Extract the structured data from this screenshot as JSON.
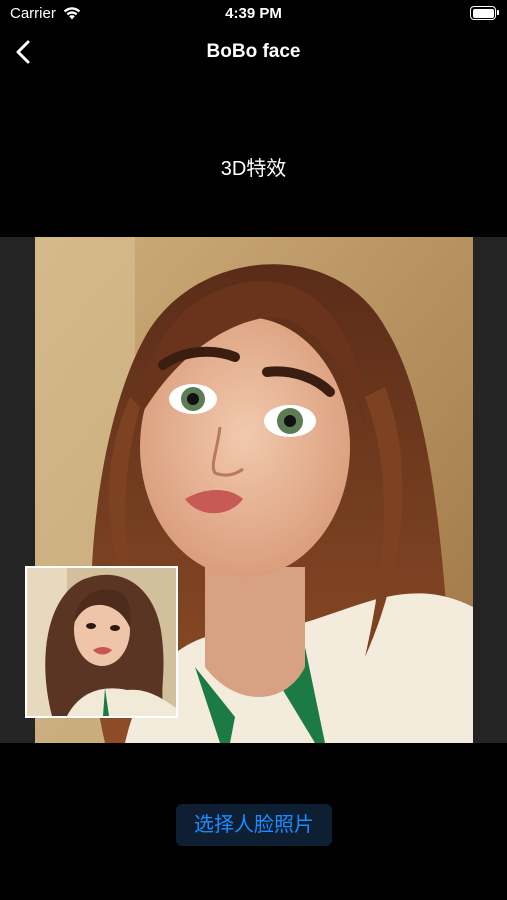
{
  "status_bar": {
    "carrier": "Carrier",
    "time": "4:39 PM",
    "wifi_icon": "wifi-icon",
    "battery_icon": "battery-icon"
  },
  "nav": {
    "title": "BoBo face",
    "back_icon": "chevron-left-icon"
  },
  "effect_label": "3D特效",
  "images": {
    "result": "cartoon-3d-face-image",
    "original": "original-photo-thumbnail"
  },
  "select_button": {
    "label": "选择人脸照片"
  },
  "colors": {
    "background": "#000000",
    "image_area": "#242424",
    "button_bg": "#0e1f33",
    "button_text": "#1a8cff"
  }
}
